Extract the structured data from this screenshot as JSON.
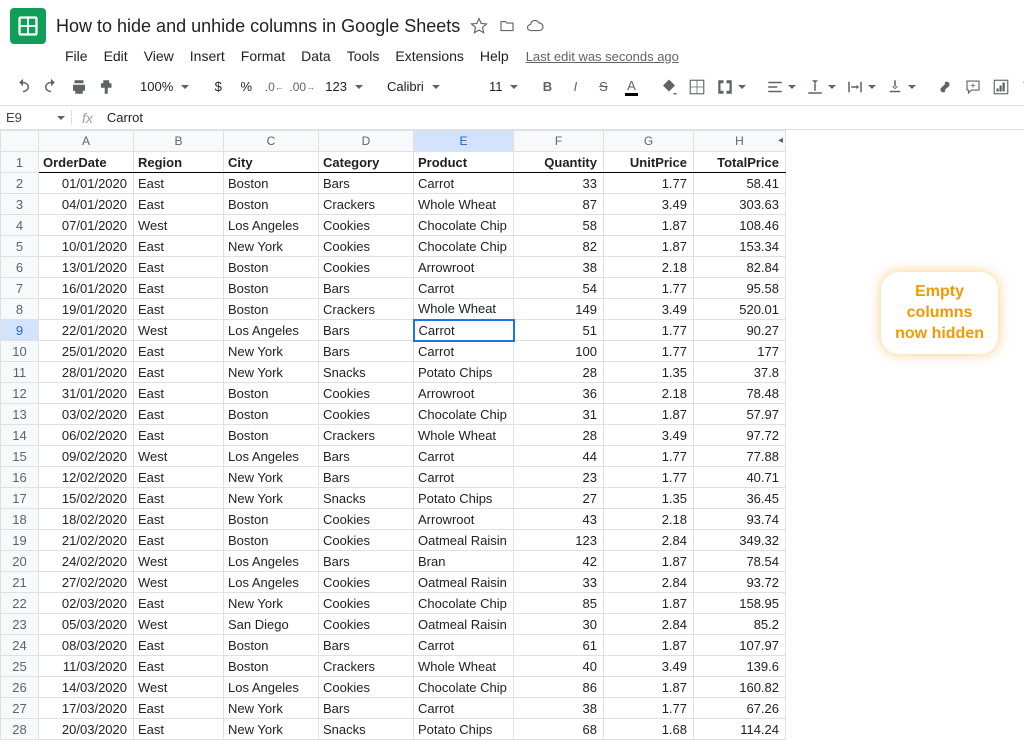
{
  "title": "How to hide and unhide columns in Google Sheets",
  "menus": [
    "File",
    "Edit",
    "View",
    "Insert",
    "Format",
    "Data",
    "Tools",
    "Extensions",
    "Help"
  ],
  "last_edit": "Last edit was seconds ago",
  "toolbar": {
    "zoom": "100%",
    "currency": "$",
    "percent": "%",
    "dec_dec": ".0",
    "inc_dec": ".00",
    "numfmt": "123",
    "font": "Calibri",
    "size": "11"
  },
  "namebox": "E9",
  "cellvalue": "Carrot",
  "columns": [
    "A",
    "B",
    "C",
    "D",
    "E",
    "F",
    "G",
    "H"
  ],
  "headers": [
    "OrderDate",
    "Region",
    "City",
    "Category",
    "Product",
    "Quantity",
    "UnitPrice",
    "TotalPrice"
  ],
  "rows": [
    [
      "01/01/2020",
      "East",
      "Boston",
      "Bars",
      "Carrot",
      "33",
      "1.77",
      "58.41"
    ],
    [
      "04/01/2020",
      "East",
      "Boston",
      "Crackers",
      "Whole Wheat",
      "87",
      "3.49",
      "303.63"
    ],
    [
      "07/01/2020",
      "West",
      "Los Angeles",
      "Cookies",
      "Chocolate Chip",
      "58",
      "1.87",
      "108.46"
    ],
    [
      "10/01/2020",
      "East",
      "New York",
      "Cookies",
      "Chocolate Chip",
      "82",
      "1.87",
      "153.34"
    ],
    [
      "13/01/2020",
      "East",
      "Boston",
      "Cookies",
      "Arrowroot",
      "38",
      "2.18",
      "82.84"
    ],
    [
      "16/01/2020",
      "East",
      "Boston",
      "Bars",
      "Carrot",
      "54",
      "1.77",
      "95.58"
    ],
    [
      "19/01/2020",
      "East",
      "Boston",
      "Crackers",
      "Whole Wheat",
      "149",
      "3.49",
      "520.01"
    ],
    [
      "22/01/2020",
      "West",
      "Los Angeles",
      "Bars",
      "Carrot",
      "51",
      "1.77",
      "90.27"
    ],
    [
      "25/01/2020",
      "East",
      "New York",
      "Bars",
      "Carrot",
      "100",
      "1.77",
      "177"
    ],
    [
      "28/01/2020",
      "East",
      "New York",
      "Snacks",
      "Potato Chips",
      "28",
      "1.35",
      "37.8"
    ],
    [
      "31/01/2020",
      "East",
      "Boston",
      "Cookies",
      "Arrowroot",
      "36",
      "2.18",
      "78.48"
    ],
    [
      "03/02/2020",
      "East",
      "Boston",
      "Cookies",
      "Chocolate Chip",
      "31",
      "1.87",
      "57.97"
    ],
    [
      "06/02/2020",
      "East",
      "Boston",
      "Crackers",
      "Whole Wheat",
      "28",
      "3.49",
      "97.72"
    ],
    [
      "09/02/2020",
      "West",
      "Los Angeles",
      "Bars",
      "Carrot",
      "44",
      "1.77",
      "77.88"
    ],
    [
      "12/02/2020",
      "East",
      "New York",
      "Bars",
      "Carrot",
      "23",
      "1.77",
      "40.71"
    ],
    [
      "15/02/2020",
      "East",
      "New York",
      "Snacks",
      "Potato Chips",
      "27",
      "1.35",
      "36.45"
    ],
    [
      "18/02/2020",
      "East",
      "Boston",
      "Cookies",
      "Arrowroot",
      "43",
      "2.18",
      "93.74"
    ],
    [
      "21/02/2020",
      "East",
      "Boston",
      "Cookies",
      "Oatmeal Raisin",
      "123",
      "2.84",
      "349.32"
    ],
    [
      "24/02/2020",
      "West",
      "Los Angeles",
      "Bars",
      "Bran",
      "42",
      "1.87",
      "78.54"
    ],
    [
      "27/02/2020",
      "West",
      "Los Angeles",
      "Cookies",
      "Oatmeal Raisin",
      "33",
      "2.84",
      "93.72"
    ],
    [
      "02/03/2020",
      "East",
      "New York",
      "Cookies",
      "Chocolate Chip",
      "85",
      "1.87",
      "158.95"
    ],
    [
      "05/03/2020",
      "West",
      "San Diego",
      "Cookies",
      "Oatmeal Raisin",
      "30",
      "2.84",
      "85.2"
    ],
    [
      "08/03/2020",
      "East",
      "Boston",
      "Bars",
      "Carrot",
      "61",
      "1.87",
      "107.97"
    ],
    [
      "11/03/2020",
      "East",
      "Boston",
      "Crackers",
      "Whole Wheat",
      "40",
      "3.49",
      "139.6"
    ],
    [
      "14/03/2020",
      "West",
      "Los Angeles",
      "Cookies",
      "Chocolate Chip",
      "86",
      "1.87",
      "160.82"
    ],
    [
      "17/03/2020",
      "East",
      "New York",
      "Bars",
      "Carrot",
      "38",
      "1.77",
      "67.26"
    ],
    [
      "20/03/2020",
      "East",
      "New York",
      "Snacks",
      "Potato Chips",
      "68",
      "1.68",
      "114.24"
    ]
  ],
  "selected": {
    "row": 9,
    "col": 4
  },
  "annotation": "Empty\ncolumns\nnow hidden"
}
